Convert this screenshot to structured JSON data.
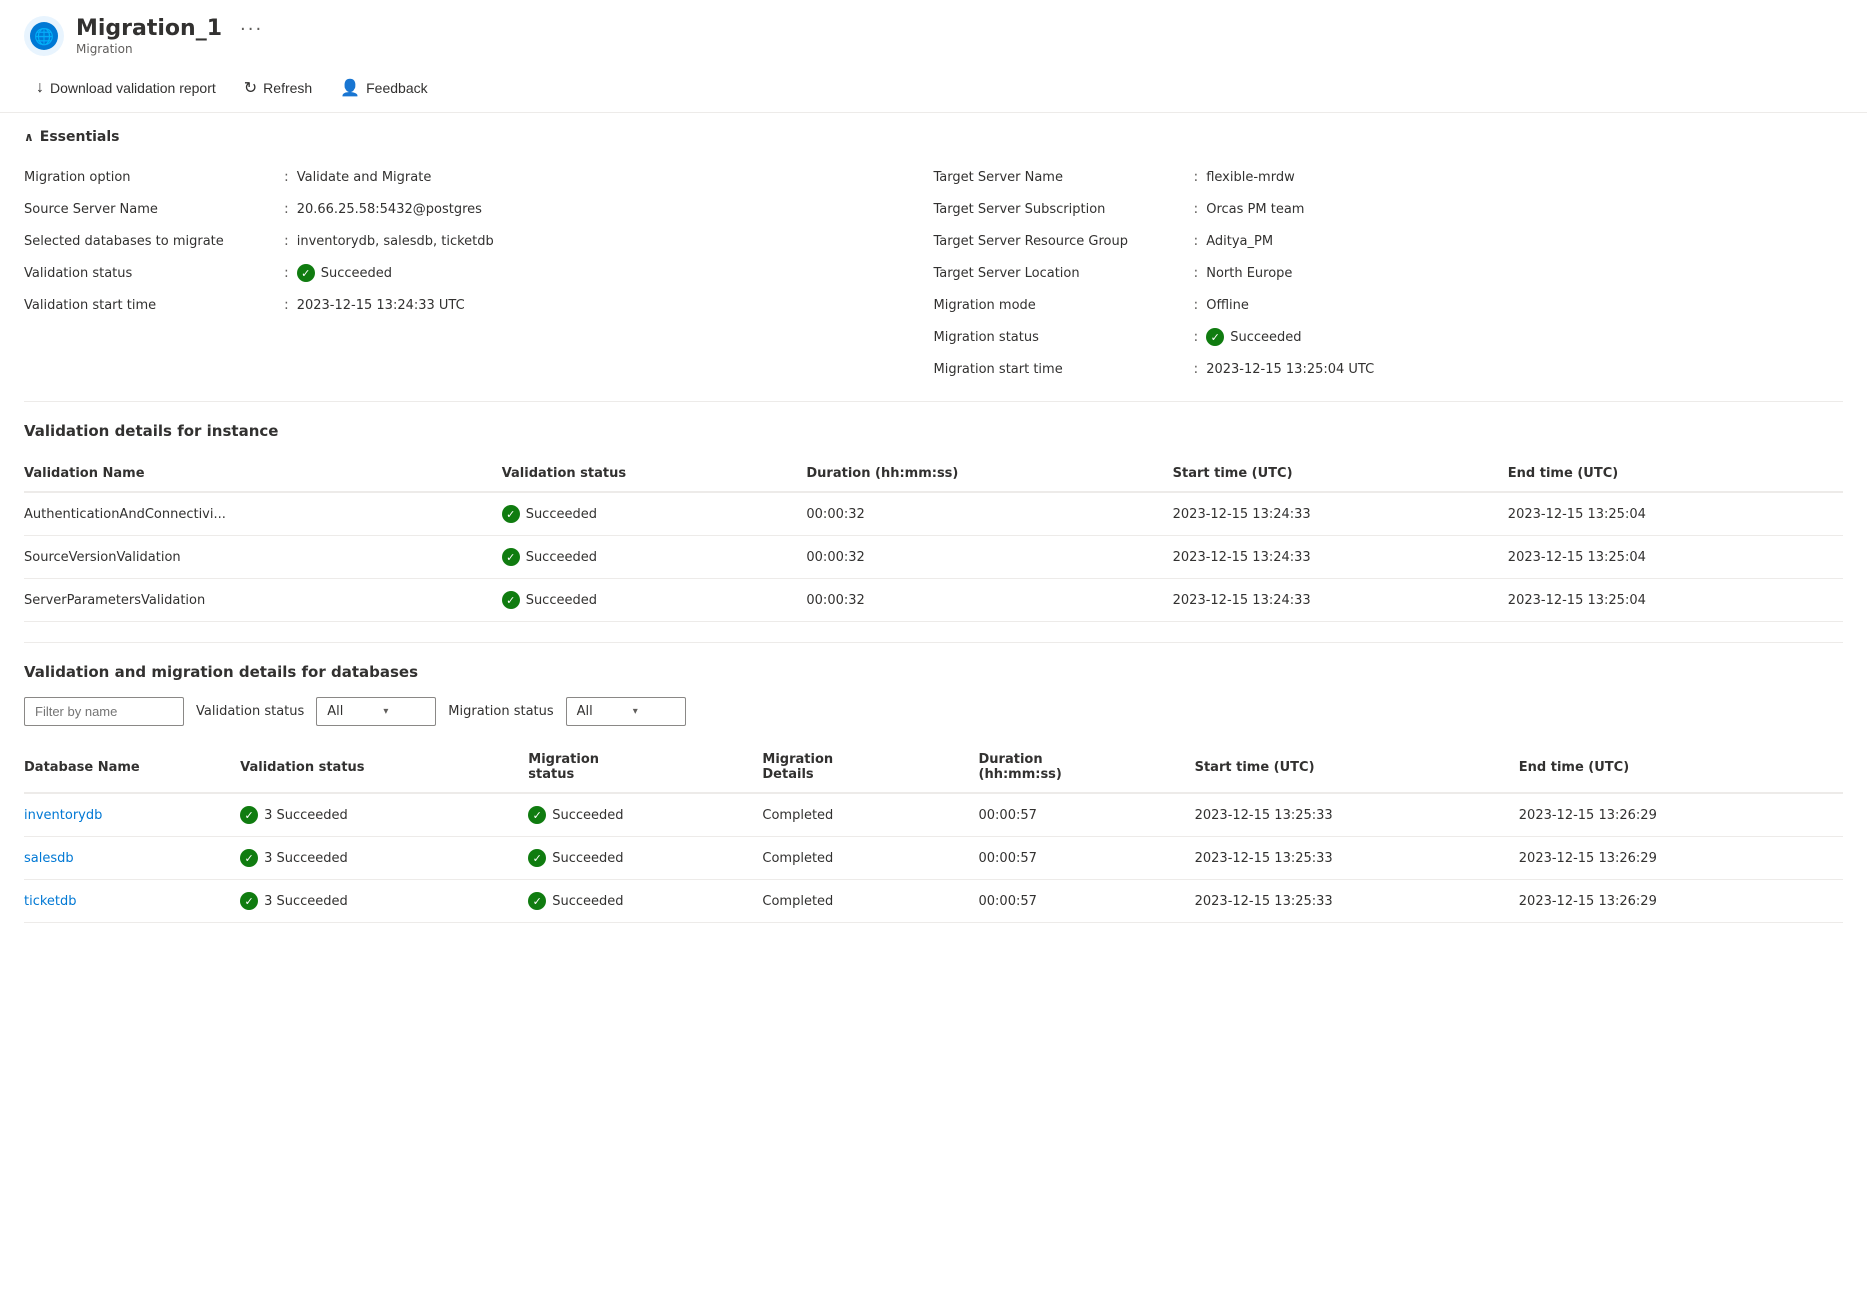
{
  "header": {
    "title": "Migration_1",
    "subtitle": "Migration",
    "more_label": "···"
  },
  "toolbar": {
    "download_label": "Download validation report",
    "refresh_label": "Refresh",
    "feedback_label": "Feedback"
  },
  "essentials": {
    "section_label": "Essentials",
    "left": [
      {
        "label": "Migration option",
        "value": "Validate and Migrate",
        "has_icon": false
      },
      {
        "label": "Source Server Name",
        "value": "20.66.25.58:5432@postgres",
        "has_icon": false
      },
      {
        "label": "Selected databases to migrate",
        "value": "inventorydb, salesdb, ticketdb",
        "has_icon": false
      },
      {
        "label": "Validation status",
        "value": "Succeeded",
        "has_icon": true
      },
      {
        "label": "Validation start time",
        "value": "2023-12-15 13:24:33 UTC",
        "has_icon": false
      }
    ],
    "right": [
      {
        "label": "Target Server Name",
        "value": "flexible-mrdw",
        "has_icon": false
      },
      {
        "label": "Target Server Subscription",
        "value": "Orcas PM team",
        "has_icon": false
      },
      {
        "label": "Target Server Resource Group",
        "value": "Aditya_PM",
        "has_icon": false
      },
      {
        "label": "Target Server Location",
        "value": "North Europe",
        "has_icon": false
      },
      {
        "label": "Migration mode",
        "value": "Offline",
        "has_icon": false
      },
      {
        "label": "Migration status",
        "value": "Succeeded",
        "has_icon": true
      },
      {
        "label": "Migration start time",
        "value": "2023-12-15 13:25:04 UTC",
        "has_icon": false
      }
    ]
  },
  "validation_instance": {
    "title": "Validation details for instance",
    "columns": [
      "Validation Name",
      "Validation status",
      "Duration (hh:mm:ss)",
      "Start time (UTC)",
      "End time (UTC)"
    ],
    "rows": [
      {
        "name": "AuthenticationAndConnectivi...",
        "status": "Succeeded",
        "duration": "00:00:32",
        "start": "2023-12-15 13:24:33",
        "end": "2023-12-15 13:25:04"
      },
      {
        "name": "SourceVersionValidation",
        "status": "Succeeded",
        "duration": "00:00:32",
        "start": "2023-12-15 13:24:33",
        "end": "2023-12-15 13:25:04"
      },
      {
        "name": "ServerParametersValidation",
        "status": "Succeeded",
        "duration": "00:00:32",
        "start": "2023-12-15 13:24:33",
        "end": "2023-12-15 13:25:04"
      }
    ]
  },
  "validation_databases": {
    "title": "Validation and migration details for databases",
    "filter_placeholder": "Filter by name",
    "validation_status_label": "Validation status",
    "migration_status_label": "Migration status",
    "filter_all": "All",
    "columns": [
      "Database Name",
      "Validation status",
      "Migration status",
      "Migration Details",
      "Duration (hh:mm:ss)",
      "Start time (UTC)",
      "End time (UTC)"
    ],
    "rows": [
      {
        "name": "inventorydb",
        "val_status": "3 Succeeded",
        "mig_status": "Succeeded",
        "mig_details": "Completed",
        "duration": "00:00:57",
        "start": "2023-12-15 13:25:33",
        "end": "2023-12-15 13:26:29"
      },
      {
        "name": "salesdb",
        "val_status": "3 Succeeded",
        "mig_status": "Succeeded",
        "mig_details": "Completed",
        "duration": "00:00:57",
        "start": "2023-12-15 13:25:33",
        "end": "2023-12-15 13:26:29"
      },
      {
        "name": "ticketdb",
        "val_status": "3 Succeeded",
        "mig_status": "Succeeded",
        "mig_details": "Completed",
        "duration": "00:00:57",
        "start": "2023-12-15 13:25:33",
        "end": "2023-12-15 13:26:29"
      }
    ]
  },
  "colors": {
    "success_green": "#107c10",
    "link_blue": "#0078d4"
  }
}
